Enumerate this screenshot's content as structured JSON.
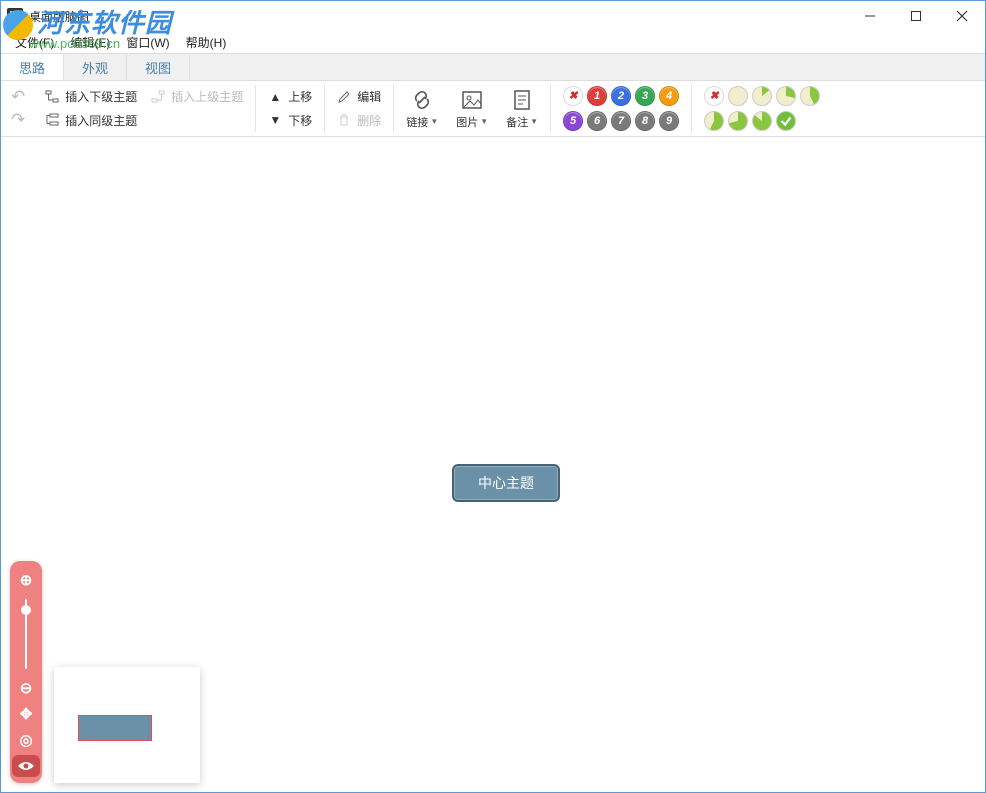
{
  "watermark": {
    "line1": "河东软件园",
    "line2": "www.pc0359.cn"
  },
  "window": {
    "title": "桌面版脑图",
    "controls": {
      "min": "minimize",
      "max": "maximize",
      "close": "close"
    }
  },
  "menubar": {
    "file": "文件(F)",
    "edit": "编辑(E)",
    "window": "窗口(W)",
    "help": "帮助(H)"
  },
  "tabs": {
    "mind": "思路",
    "appearance": "外观",
    "view": "视图",
    "active": "mind"
  },
  "toolbar": {
    "undo": "↶",
    "redo": "↷",
    "insert_child": "插入下级主题",
    "insert_parent": "插入上级主题",
    "insert_sibling": "插入同级主题",
    "move_up": "上移",
    "move_down": "下移",
    "edit": "编辑",
    "delete": "删除",
    "link": "链接",
    "image": "图片",
    "note": "备注",
    "priority": {
      "clear_icon": "✖",
      "values": [
        "1",
        "2",
        "3",
        "4",
        "5",
        "6",
        "7",
        "8",
        "9"
      ],
      "colors": [
        "#e23b3b",
        "#3b6fe2",
        "#34a853",
        "#f59b11",
        "#8a46d6",
        "#7a7a7a",
        "#7a7a7a",
        "#7a7a7a",
        "#7a7a7a"
      ]
    },
    "progress": {
      "clear_icon": "✖",
      "steps": 8
    }
  },
  "canvas": {
    "center_label": "中心主题"
  },
  "navigator": {
    "zoom_in_icon": "⊕",
    "zoom_out_icon": "⊖",
    "move_icon": "✥",
    "locate_icon": "◎",
    "eye_icon": "eye"
  }
}
